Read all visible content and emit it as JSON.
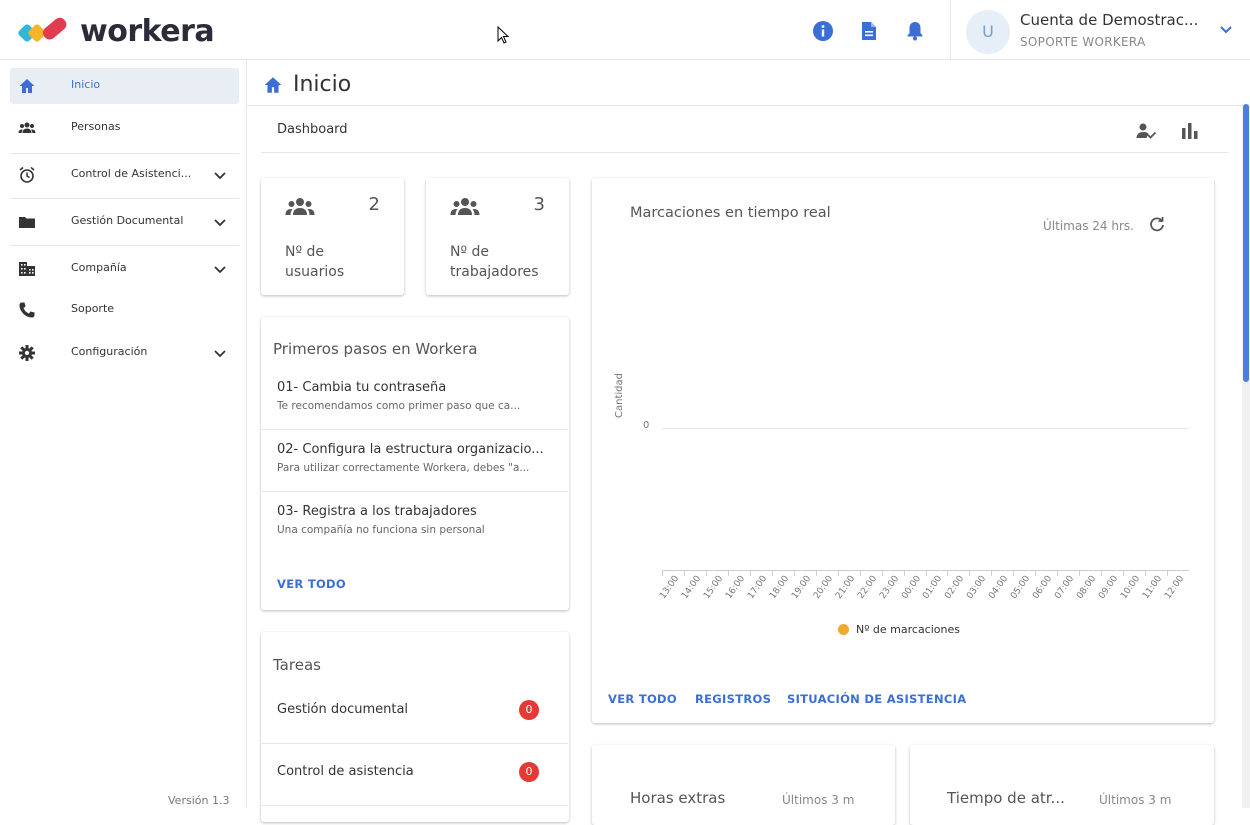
{
  "header": {
    "logo_text": "workera",
    "account_name": "Cuenta de Demostrac...",
    "account_role": "SOPORTE WORKERA",
    "avatar_initial": "U"
  },
  "sidebar": {
    "items": [
      {
        "label": "Inicio",
        "icon": "home-icon",
        "active": true
      },
      {
        "label": "Personas",
        "icon": "people-icon"
      },
      {
        "label": "Control de Asistenci...",
        "icon": "alarm-icon"
      },
      {
        "label": "Gestión Documental",
        "icon": "folder-icon"
      },
      {
        "label": "Compañía",
        "icon": "building-icon"
      },
      {
        "label": "Soporte",
        "icon": "phone-icon"
      },
      {
        "label": "Configuración",
        "icon": "gear-icon"
      }
    ],
    "version": "Versión 1.3"
  },
  "page": {
    "title": "Inicio",
    "tab_label": "Dashboard"
  },
  "stats": {
    "users": {
      "value": "2",
      "label": "Nº de usuarios"
    },
    "workers": {
      "value": "3",
      "label": "Nº de trabajadores"
    }
  },
  "first_steps": {
    "title": "Primeros pasos en Workera",
    "steps": [
      {
        "title": "01- Cambia tu contraseña",
        "desc": "Te recomendamos como primer paso que ca..."
      },
      {
        "title": "02- Configura la estructura organizacio...",
        "desc": "Para utilizar correctamente Workera, debes \"a..."
      },
      {
        "title": "03- Registra a los trabajadores",
        "desc": "Una compañía no funciona sin personal"
      }
    ],
    "link": "VER TODO"
  },
  "tasks": {
    "title": "Tareas",
    "items": [
      {
        "label": "Gestión documental",
        "count": "0"
      },
      {
        "label": "Control de asistencia",
        "count": "0"
      }
    ]
  },
  "realtime": {
    "title": "Marcaciones en tiempo real",
    "range": "Últimas 24 hrs.",
    "links": [
      "VER TODO",
      "REGISTROS",
      "SITUACIÓN DE ASISTENCIA"
    ]
  },
  "overtime": {
    "title": "Horas extras",
    "range": "Últimos 3 m"
  },
  "delay": {
    "title": "Tiempo de atr...",
    "range": "Últimos 3 m"
  },
  "colors": {
    "accent": "#3b6fd6",
    "badge": "#e53935",
    "legend": "#f0a92e"
  },
  "chart_data": {
    "type": "line",
    "title": "",
    "ylabel": "Cantidad",
    "xlabel": "",
    "yticks": [
      "0"
    ],
    "x": [
      "13:00",
      "14:00",
      "15:00",
      "16:00",
      "17:00",
      "18:00",
      "19:00",
      "20:00",
      "21:00",
      "22:00",
      "23:00",
      "00:00",
      "01:00",
      "02:00",
      "03:00",
      "04:00",
      "05:00",
      "06:00",
      "07:00",
      "08:00",
      "09:00",
      "10:00",
      "11:00",
      "12:00"
    ],
    "series": [
      {
        "name": "Nº de marcaciones",
        "values": []
      }
    ],
    "legend": "bottom"
  }
}
